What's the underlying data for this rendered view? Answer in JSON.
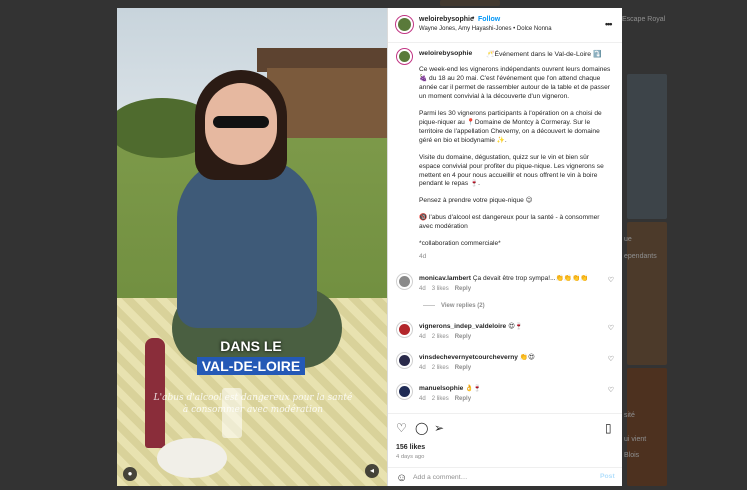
{
  "background": {
    "labels": [
      "Escape Royal",
      "ependants",
      "ue",
      "sité",
      "ui vient",
      "Blois"
    ]
  },
  "post": {
    "username": "weloirebysophie",
    "follow_label": "Follow",
    "dot": "•",
    "collab_line": "Wayne Jones, Amy Hayashi-Jones • Dolce Nonna",
    "more_icon": "more-horizontal-icon",
    "media": {
      "caption_line1": "DANS LE",
      "caption_line2": "VAL-DE-LOIRE",
      "overlay_text": "L'abus d'alcool est dangereux pour la santé à consommer avec modération"
    },
    "caption": {
      "username": "weloirebysophie",
      "title": "🥂Événement dans le Val-de-Loire ⤵️",
      "paragraphs": [
        "Ce week-end les vignerons indépendants ouvrent leurs domaines 🍇 du 18 au 20 mai. C'est l'événement que l'on attend chaque année car il permet de rassembler autour de la table et de passer un moment convivial à la découverte d'un vigneron.",
        "Parmi les 30 vignerons participants à l'opération on a choisi de pique-niquer au 📍Domaine de Montcy à Cormeray. Sur le territoire de l'appellation Cheverny, on a découvert le domaine géré en bio et biodynamie ✨.",
        "Visite du domaine, dégustation, quizz sur le vin et bien sûr espace convivial pour profiter du pique-nique. Les vignerons se mettent en 4 pour nous accueillir et nous offrent le vin à boire pendant le repas 🍷.",
        "Pensez à prendre votre pique-nique 😉",
        "🔞 l'abus d'alcool est dangereux pour la santé - à consommer avec modération",
        "*collaboration commerciale*"
      ],
      "age": "4d"
    },
    "comments": [
      {
        "username": "monicav.lambert",
        "text": "Ça devait être trop sympa!...👏👏👏👏",
        "age": "4d",
        "likes": "3 likes",
        "reply": "Reply",
        "view_replies": "View replies (2)"
      },
      {
        "username": "vignerons_indep_valdeloire",
        "text": "😍🍷",
        "age": "4d",
        "likes": "2 likes",
        "reply": "Reply"
      },
      {
        "username": "vinsdechevernyetcourcheverny",
        "text": "👏😍",
        "age": "4d",
        "likes": "2 likes",
        "reply": "Reply"
      },
      {
        "username": "manuelsophie",
        "text": "👌🍷",
        "age": "4d",
        "likes": "2 likes",
        "reply": "Reply"
      }
    ],
    "likes": "156 likes",
    "time": "4 days ago",
    "add_comment_placeholder": "Add a comment…",
    "post_label": "Post"
  },
  "colors": {
    "accent": "#0095f6",
    "caption_band": "#2459b6"
  }
}
